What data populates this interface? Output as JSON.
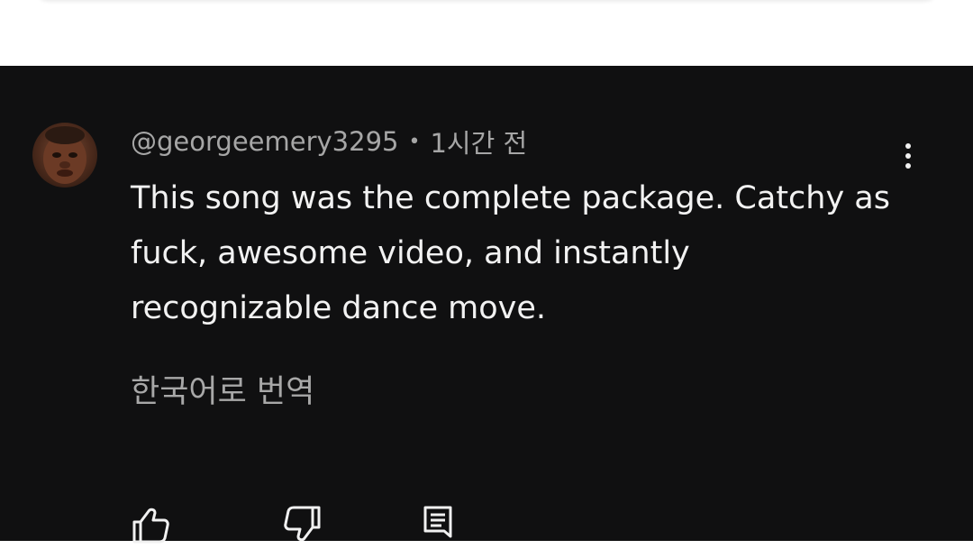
{
  "comment": {
    "author": "@georgeemery3295",
    "separator": "•",
    "timestamp": "1시간 전",
    "text": "This song was the complete package. Catchy as fuck, awesome video, and instantly recognizable dance move.",
    "translate_label": "한국어로 번역"
  },
  "icons": {
    "more": "more-vertical-icon",
    "like": "thumbs-up-icon",
    "dislike": "thumbs-down-icon",
    "reply": "reply-comment-icon"
  },
  "colors": {
    "panel_bg": "#101011",
    "text_primary": "#f2f2f2",
    "text_secondary": "#a6a6a6",
    "top_bg": "#ffffff"
  }
}
